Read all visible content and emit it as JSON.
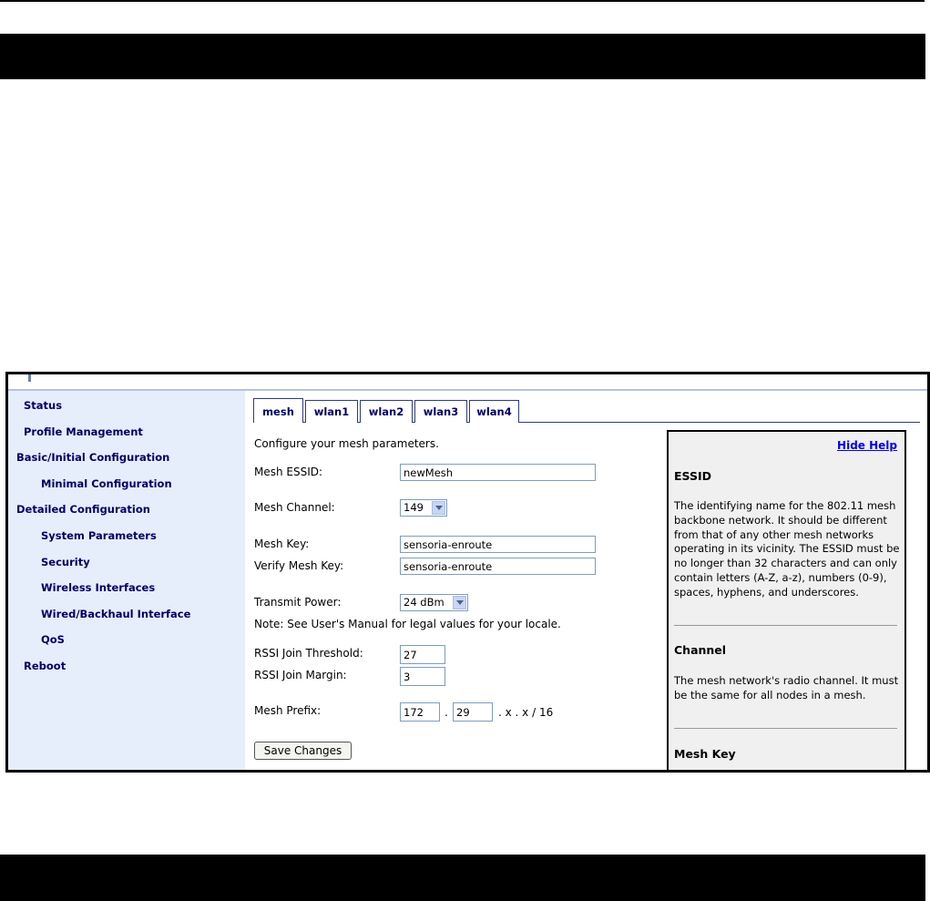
{
  "sidebar": {
    "items": [
      {
        "label": "Status"
      },
      {
        "label": "Profile Management"
      },
      {
        "label": "Basic/Initial Configuration"
      },
      {
        "label": "Minimal Configuration"
      },
      {
        "label": "Detailed Configuration"
      },
      {
        "label": "System Parameters"
      },
      {
        "label": "Security"
      },
      {
        "label": "Wireless Interfaces"
      },
      {
        "label": "Wired/Backhaul Interface"
      },
      {
        "label": "QoS"
      },
      {
        "label": "Reboot"
      }
    ]
  },
  "tabs": [
    {
      "label": "mesh",
      "active": true
    },
    {
      "label": "wlan1"
    },
    {
      "label": "wlan2"
    },
    {
      "label": "wlan3"
    },
    {
      "label": "wlan4"
    }
  ],
  "form": {
    "intro": "Configure your mesh parameters.",
    "essid_label": "Mesh ESSID:",
    "essid_value": "newMesh",
    "channel_label": "Mesh Channel:",
    "channel_value": "149",
    "key_label": "Mesh Key:",
    "key_value": "sensoria-enroute",
    "verify_label": "Verify Mesh Key:",
    "verify_value": "sensoria-enroute",
    "power_label": "Transmit Power:",
    "power_value": "24 dBm",
    "power_note": "Note: See User's Manual for legal values for your locale.",
    "rssi_threshold_label": "RSSI Join Threshold:",
    "rssi_threshold_value": "27",
    "rssi_margin_label": "RSSI Join Margin:",
    "rssi_margin_value": "3",
    "prefix_label": "Mesh Prefix:",
    "prefix_octet1": "172",
    "prefix_dot": ".",
    "prefix_octet2": "29",
    "prefix_suffix": ". x . x / 16",
    "save_label": "Save Changes"
  },
  "help": {
    "hide_label": "Hide Help",
    "essid_title": "ESSID",
    "essid_text": "The identifying name for the 802.11 mesh backbone network. It should be different from that of any other mesh networks operating in its vicinity. The ESSID must be no longer than 32 characters and can only contain letters (A-Z, a-z), numbers (0-9), spaces, hyphens, and underscores.",
    "channel_title": "Channel",
    "channel_text": "The mesh network's radio channel. It must be the same for all nodes in a mesh.",
    "key_title": "Mesh Key"
  }
}
